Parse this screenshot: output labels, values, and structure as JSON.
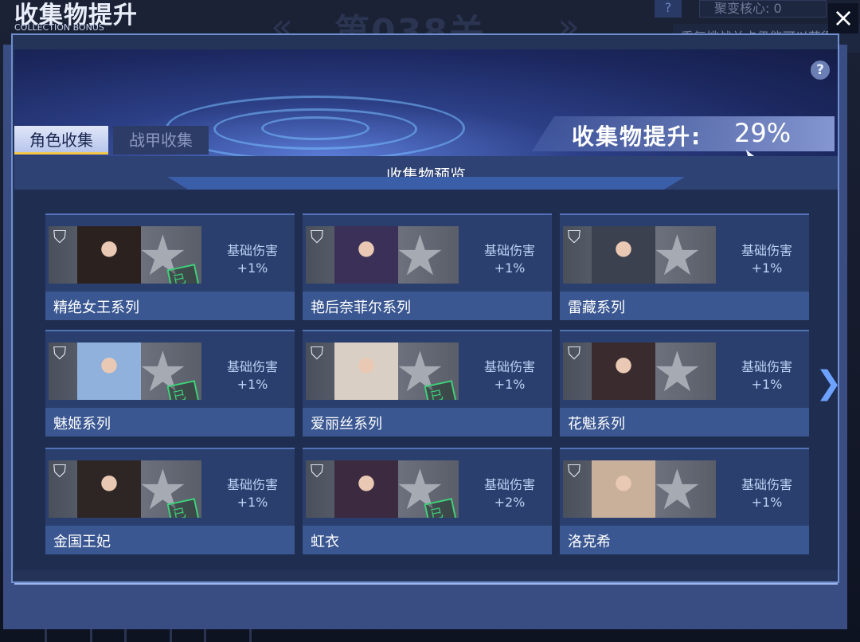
{
  "background": {
    "level_text": "第038关",
    "core_text": "聚变核心: 0",
    "help_mark": "?",
    "sub_text": "重复挑战关卡仍能可以获得"
  },
  "header": {
    "title": "收集物提升",
    "subtitle": "COLLECTION BONUS",
    "close_icon": "×"
  },
  "banner": {
    "help_mark": "?",
    "bonus_label": "收集物提升:",
    "bonus_value": "29%"
  },
  "tabs": [
    {
      "label": "角色收集",
      "active": true
    },
    {
      "label": "战甲收集",
      "active": false
    }
  ],
  "preview_title": "收集物预览",
  "owned_label": "已持有",
  "cards": [
    {
      "name": "精绝女王系列",
      "attr": "基础伤害",
      "bonus": "+1%",
      "owned": true
    },
    {
      "name": "艳后奈菲尔系列",
      "attr": "基础伤害",
      "bonus": "+1%",
      "owned": false
    },
    {
      "name": "雷藏系列",
      "attr": "基础伤害",
      "bonus": "+1%",
      "owned": false
    },
    {
      "name": "魅姬系列",
      "attr": "基础伤害",
      "bonus": "+1%",
      "owned": true
    },
    {
      "name": "爱丽丝系列",
      "attr": "基础伤害",
      "bonus": "+1%",
      "owned": true
    },
    {
      "name": "花魁系列",
      "attr": "基础伤害",
      "bonus": "+1%",
      "owned": false
    },
    {
      "name": "金国王妃",
      "attr": "基础伤害",
      "bonus": "+1%",
      "owned": true
    },
    {
      "name": "虹衣",
      "attr": "基础伤害",
      "bonus": "+2%",
      "owned": true
    },
    {
      "name": "洛克希",
      "attr": "基础伤害",
      "bonus": "+1%",
      "owned": false
    }
  ],
  "next_arrow": "❯",
  "colors": {
    "accent": "#6ea2ff",
    "owned": "#3fd07a"
  }
}
